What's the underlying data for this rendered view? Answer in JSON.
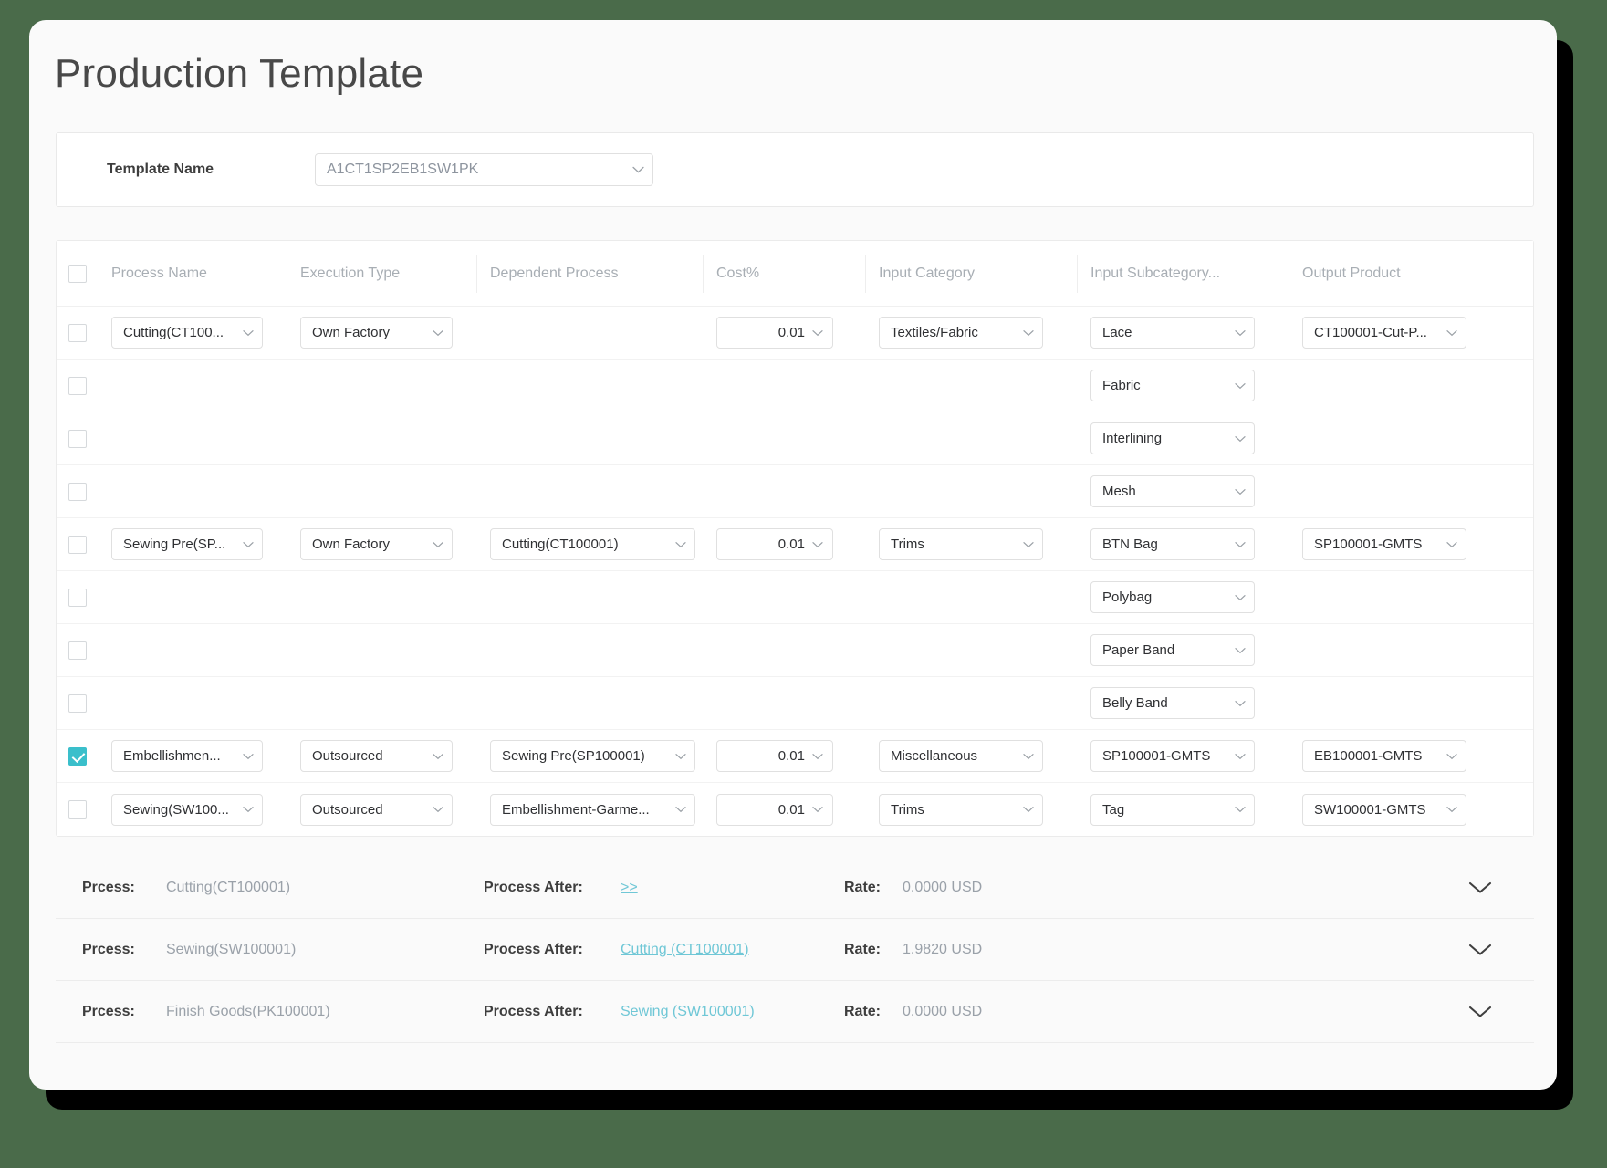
{
  "page": {
    "title": "Production Template"
  },
  "template_panel": {
    "label": "Template Name",
    "value": "A1CT1SP2EB1SW1PK"
  },
  "grid": {
    "columns": [
      "Process Name",
      "Execution Type",
      "Dependent Process",
      "Cost%",
      "Input Category",
      "Input Subcategory...",
      "Output Product"
    ],
    "rows": [
      {
        "checked": false,
        "process_name": "Cutting(CT100...",
        "execution_type": "Own Factory",
        "dependent_process": "",
        "cost": "0.01",
        "input_category": "Textiles/Fabric",
        "input_subcategory": "Lace",
        "output_product": "CT100001-Cut-P..."
      },
      {
        "checked": false,
        "process_name": "",
        "execution_type": "",
        "dependent_process": "",
        "cost": "",
        "input_category": "",
        "input_subcategory": "Fabric",
        "output_product": ""
      },
      {
        "checked": false,
        "process_name": "",
        "execution_type": "",
        "dependent_process": "",
        "cost": "",
        "input_category": "",
        "input_subcategory": "Interlining",
        "output_product": ""
      },
      {
        "checked": false,
        "process_name": "",
        "execution_type": "",
        "dependent_process": "",
        "cost": "",
        "input_category": "",
        "input_subcategory": "Mesh",
        "output_product": ""
      },
      {
        "checked": false,
        "process_name": "Sewing Pre(SP...",
        "execution_type": "Own Factory",
        "dependent_process": "Cutting(CT100001)",
        "cost": "0.01",
        "input_category": "Trims",
        "input_subcategory": "BTN Bag",
        "output_product": "SP100001-GMTS"
      },
      {
        "checked": false,
        "process_name": "",
        "execution_type": "",
        "dependent_process": "",
        "cost": "",
        "input_category": "",
        "input_subcategory": "Polybag",
        "output_product": ""
      },
      {
        "checked": false,
        "process_name": "",
        "execution_type": "",
        "dependent_process": "",
        "cost": "",
        "input_category": "",
        "input_subcategory": "Paper Band",
        "output_product": ""
      },
      {
        "checked": false,
        "process_name": "",
        "execution_type": "",
        "dependent_process": "",
        "cost": "",
        "input_category": "",
        "input_subcategory": "Belly Band",
        "output_product": ""
      },
      {
        "checked": true,
        "process_name": "Embellishmen...",
        "execution_type": "Outsourced",
        "dependent_process": "Sewing Pre(SP100001)",
        "cost": "0.01",
        "input_category": "Miscellaneous",
        "input_subcategory": "SP100001-GMTS",
        "output_product": "EB100001-GMTS"
      },
      {
        "checked": false,
        "process_name": "Sewing(SW100...",
        "execution_type": "Outsourced",
        "dependent_process": "Embellishment-Garme...",
        "cost": "0.01",
        "input_category": "Trims",
        "input_subcategory": "Tag",
        "output_product": "SW100001-GMTS"
      }
    ]
  },
  "process_list": {
    "process_label": "Prcess:",
    "process_after_label": "Process After:",
    "rate_label": "Rate:",
    "rows": [
      {
        "process": "Cutting(CT100001)",
        "process_after": ">>",
        "rate": "0.0000 USD"
      },
      {
        "process": "Sewing(SW100001)",
        "process_after": "Cutting (CT100001)",
        "rate": "1.9820 USD"
      },
      {
        "process": "Finish Goods(PK100001)",
        "process_after": "Sewing (SW100001)",
        "rate": "0.0000 USD"
      }
    ]
  },
  "colors": {
    "accent_teal": "#3abfcb",
    "link_teal": "#6fc7d6",
    "page_background": "#4a6b4a"
  }
}
